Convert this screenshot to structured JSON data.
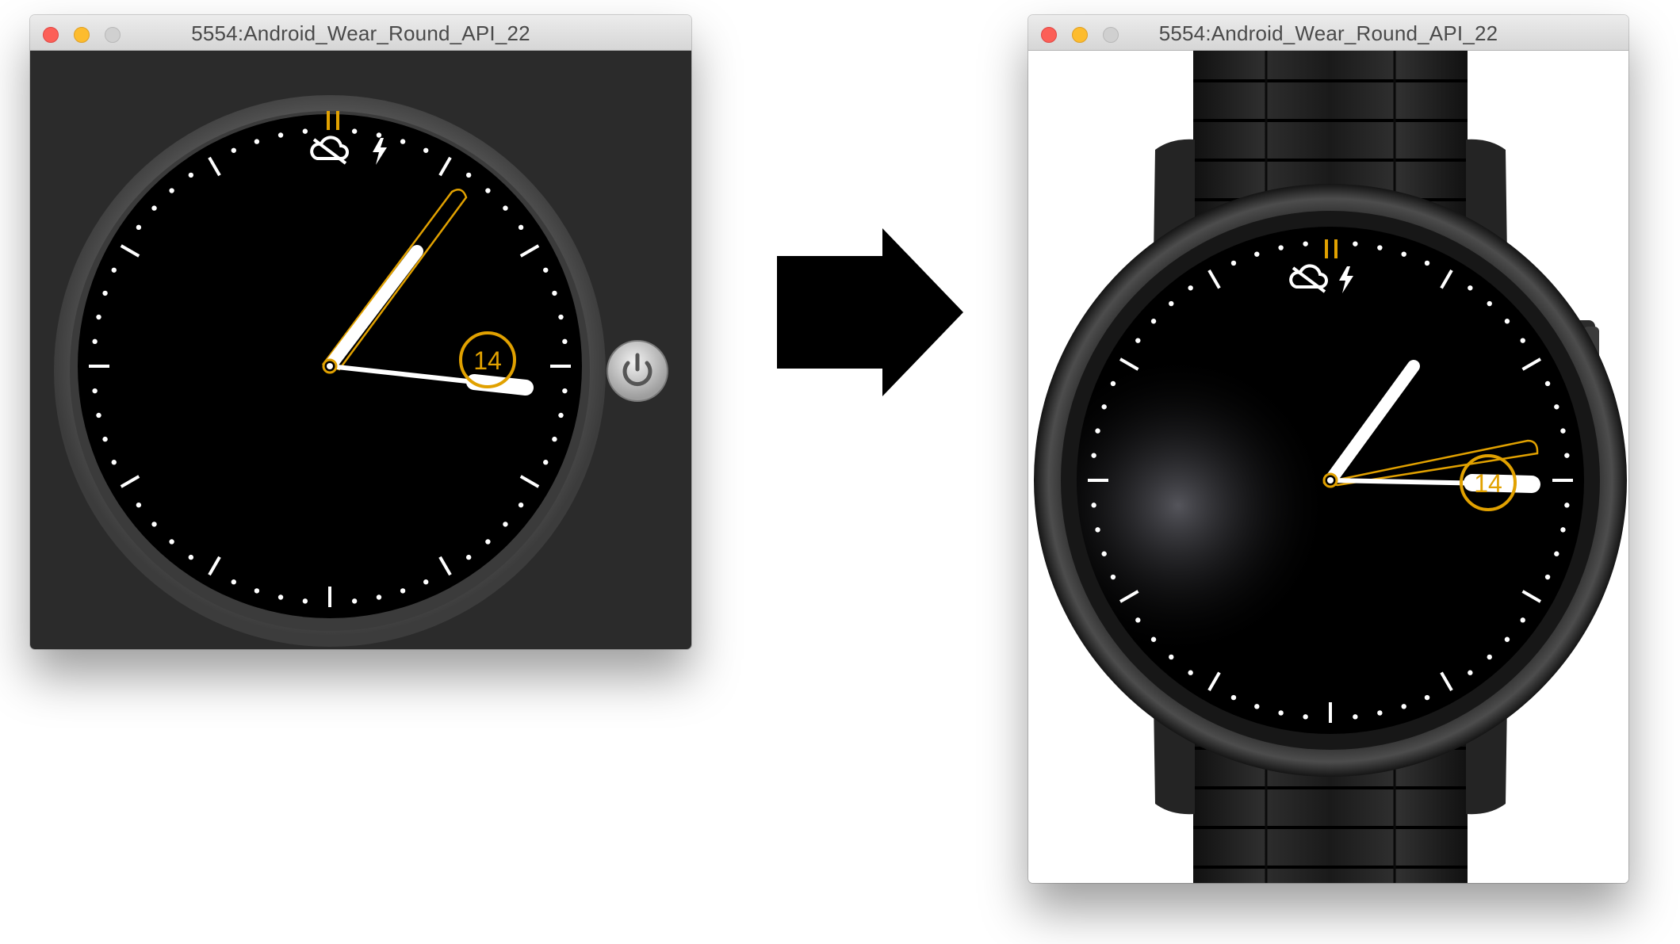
{
  "left_window": {
    "title": "5554:Android_Wear_Round_API_22",
    "date_badge": "14",
    "icons": [
      "cloud-off-icon",
      "lightning-icon",
      "power-icon"
    ]
  },
  "right_window": {
    "title": "5554:Android_Wear_Round_API_22",
    "date_badge": "14",
    "icons": [
      "cloud-off-icon",
      "lightning-icon"
    ]
  },
  "arrow": {
    "direction": "right"
  },
  "colors": {
    "accent": "#e1a100",
    "dark_frame": "#2b2b2b",
    "bezel": "#4a4a4a",
    "watch_body": "#1c1c1c"
  }
}
